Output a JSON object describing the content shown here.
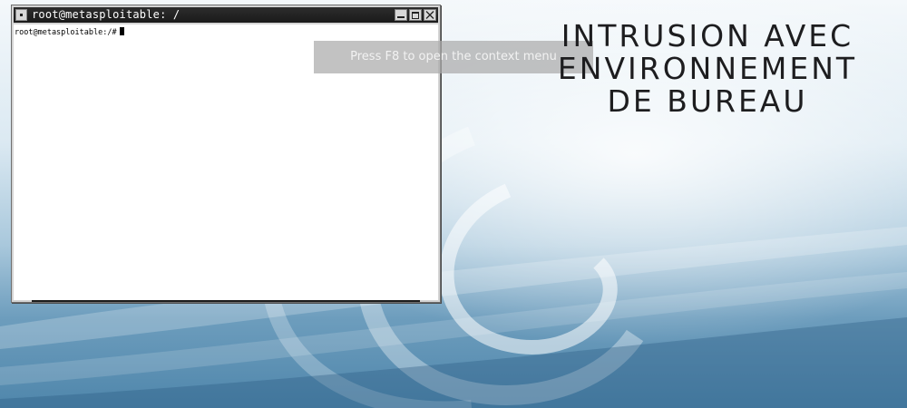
{
  "desktop": {
    "wallpaper": "debian-swirl-blue",
    "colors": {
      "sky_top": "#f4f8fb",
      "sky_bottom": "#4f86ab"
    }
  },
  "terminal": {
    "title": "root@metasploitable: /",
    "prompt": "root@metasploitable:/#",
    "buttons": {
      "minimize": "minimize-icon",
      "maximize": "maximize-icon",
      "close": "close-icon"
    },
    "colors": {
      "titlebar": "#1a1a1a",
      "body": "#ffffff"
    }
  },
  "tooltip": {
    "text": "Press F8 to open the context menu"
  },
  "heading": {
    "line1": "INTRUSION AVEC",
    "line2": "ENVIRONNEMENT",
    "line3": "DE BUREAU"
  }
}
